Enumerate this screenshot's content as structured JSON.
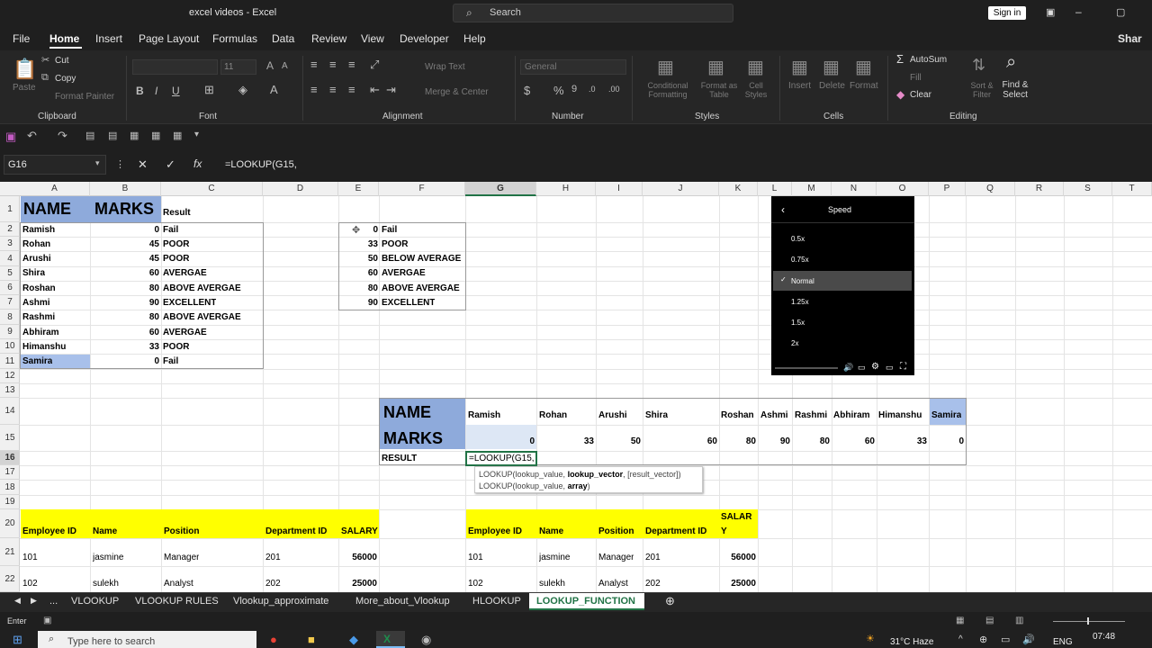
{
  "window": {
    "title": "excel videos  -  Excel",
    "search_placeholder": "Search",
    "signin": "Sign in",
    "share": "Shar"
  },
  "menu": [
    "File",
    "Home",
    "Insert",
    "Page Layout",
    "Formulas",
    "Data",
    "Review",
    "View",
    "Developer",
    "Help"
  ],
  "ribbon": {
    "clipboard": {
      "cut": "Cut",
      "copy": "Copy",
      "format_painter": "Format Painter",
      "paste": "Paste",
      "group": "Clipboard"
    },
    "font": {
      "group": "Font",
      "size": "11"
    },
    "alignment": {
      "wrap": "Wrap Text",
      "merge": "Merge & Center",
      "group": "Alignment"
    },
    "number": {
      "format": "General",
      "group": "Number"
    },
    "styles": {
      "cond": "Conditional Formatting",
      "table": "Format as Table",
      "cell": "Cell Styles",
      "group": "Styles"
    },
    "cells": {
      "insert": "Insert",
      "delete": "Delete",
      "format": "Format",
      "group": "Cells"
    },
    "editing": {
      "autosum": "AutoSum",
      "fill": "Fill",
      "clear": "Clear",
      "sort": "Sort & Filter",
      "find": "Find & Select",
      "group": "Editing"
    }
  },
  "formula_bar": {
    "name_box": "G16",
    "formula": "=LOOKUP(G15,"
  },
  "columns": [
    "A",
    "B",
    "C",
    "D",
    "E",
    "F",
    "G",
    "H",
    "I",
    "J",
    "K",
    "L",
    "M",
    "N",
    "O",
    "P",
    "Q",
    "R",
    "S",
    "T"
  ],
  "rows": [
    "1",
    "2",
    "3",
    "4",
    "5",
    "6",
    "7",
    "8",
    "9",
    "10",
    "11",
    "12",
    "13",
    "14",
    "15",
    "16",
    "17",
    "18",
    "19",
    "20",
    "21",
    "22"
  ],
  "table1": {
    "h_name": "NAME",
    "h_marks": "MARKS",
    "h_result": "Result",
    "rows": [
      [
        "Ramish",
        "0",
        "Fail"
      ],
      [
        "Rohan",
        "45",
        "POOR"
      ],
      [
        "Arushi",
        "45",
        "POOR"
      ],
      [
        "Shira",
        "60",
        "AVERGAE"
      ],
      [
        "Roshan",
        "80",
        "ABOVE AVERGAE"
      ],
      [
        "Ashmi",
        "90",
        "EXCELLENT"
      ],
      [
        "Rashmi",
        "80",
        "ABOVE AVERGAE"
      ],
      [
        "Abhiram",
        "60",
        "AVERGAE"
      ],
      [
        "Himanshu",
        "33",
        "POOR"
      ],
      [
        "Samira",
        "0",
        "Fail"
      ]
    ]
  },
  "lookup": [
    [
      "0",
      "Fail"
    ],
    [
      "33",
      "POOR"
    ],
    [
      "50",
      "BELOW AVERAGE"
    ],
    [
      "60",
      "AVERGAE"
    ],
    [
      "80",
      "ABOVE AVERGAE"
    ],
    [
      "90",
      "EXCELLENT"
    ]
  ],
  "htable": {
    "h_name": "NAME",
    "h_marks": "MARKS",
    "h_result": "RESULT",
    "names": [
      "Ramish",
      "Rohan",
      "Arushi",
      "Shira",
      "Roshan",
      "Ashmi",
      "Rashmi",
      "Abhiram",
      "Himanshu",
      "Samira"
    ],
    "marks": [
      "0",
      "33",
      "50",
      "60",
      "80",
      "90",
      "80",
      "60",
      "33",
      "0"
    ],
    "editing": "=LOOKUP(G15,",
    "tooltip1_a": "LOOKUP(lookup_value, ",
    "tooltip1_b": "lookup_vector",
    "tooltip1_c": ", [result_vector])",
    "tooltip2_a": "LOOKUP(lookup_value, ",
    "tooltip2_b": "array",
    "tooltip2_c": ")"
  },
  "emp_left": {
    "headers": [
      "Employee ID",
      "Name",
      "Position",
      "Department ID",
      "SALARY"
    ],
    "rows": [
      [
        "101",
        "jasmine",
        "Manager",
        "201",
        "56000"
      ],
      [
        "102",
        "sulekh",
        "Analyst",
        "202",
        "25000"
      ]
    ]
  },
  "emp_right": {
    "headers": [
      "Employee ID",
      "Name",
      "Position",
      "Department ID",
      "SALAR",
      "Y"
    ],
    "rows": [
      [
        "101",
        "jasmine",
        "Manager",
        "201",
        "56000"
      ],
      [
        "102",
        "sulekh",
        "Analyst",
        "202",
        "25000"
      ]
    ]
  },
  "speed_menu": {
    "title": "Speed",
    "options": [
      "0.5x",
      "0.75x",
      "Normal",
      "1.25x",
      "1.5x",
      "2x"
    ],
    "selected": "Normal"
  },
  "sheet_tabs": [
    "...",
    "VLOOKUP",
    "VLOOKUP RULES",
    "Vlookup_approximate",
    "More_about_Vlookup",
    "HLOOKUP",
    "LOOKUP_FUNCTION"
  ],
  "status": {
    "mode": "Enter"
  },
  "taskbar": {
    "search": "Type here to search",
    "weather": "31°C  Haze",
    "lang": "ENG",
    "time": "07:48"
  }
}
